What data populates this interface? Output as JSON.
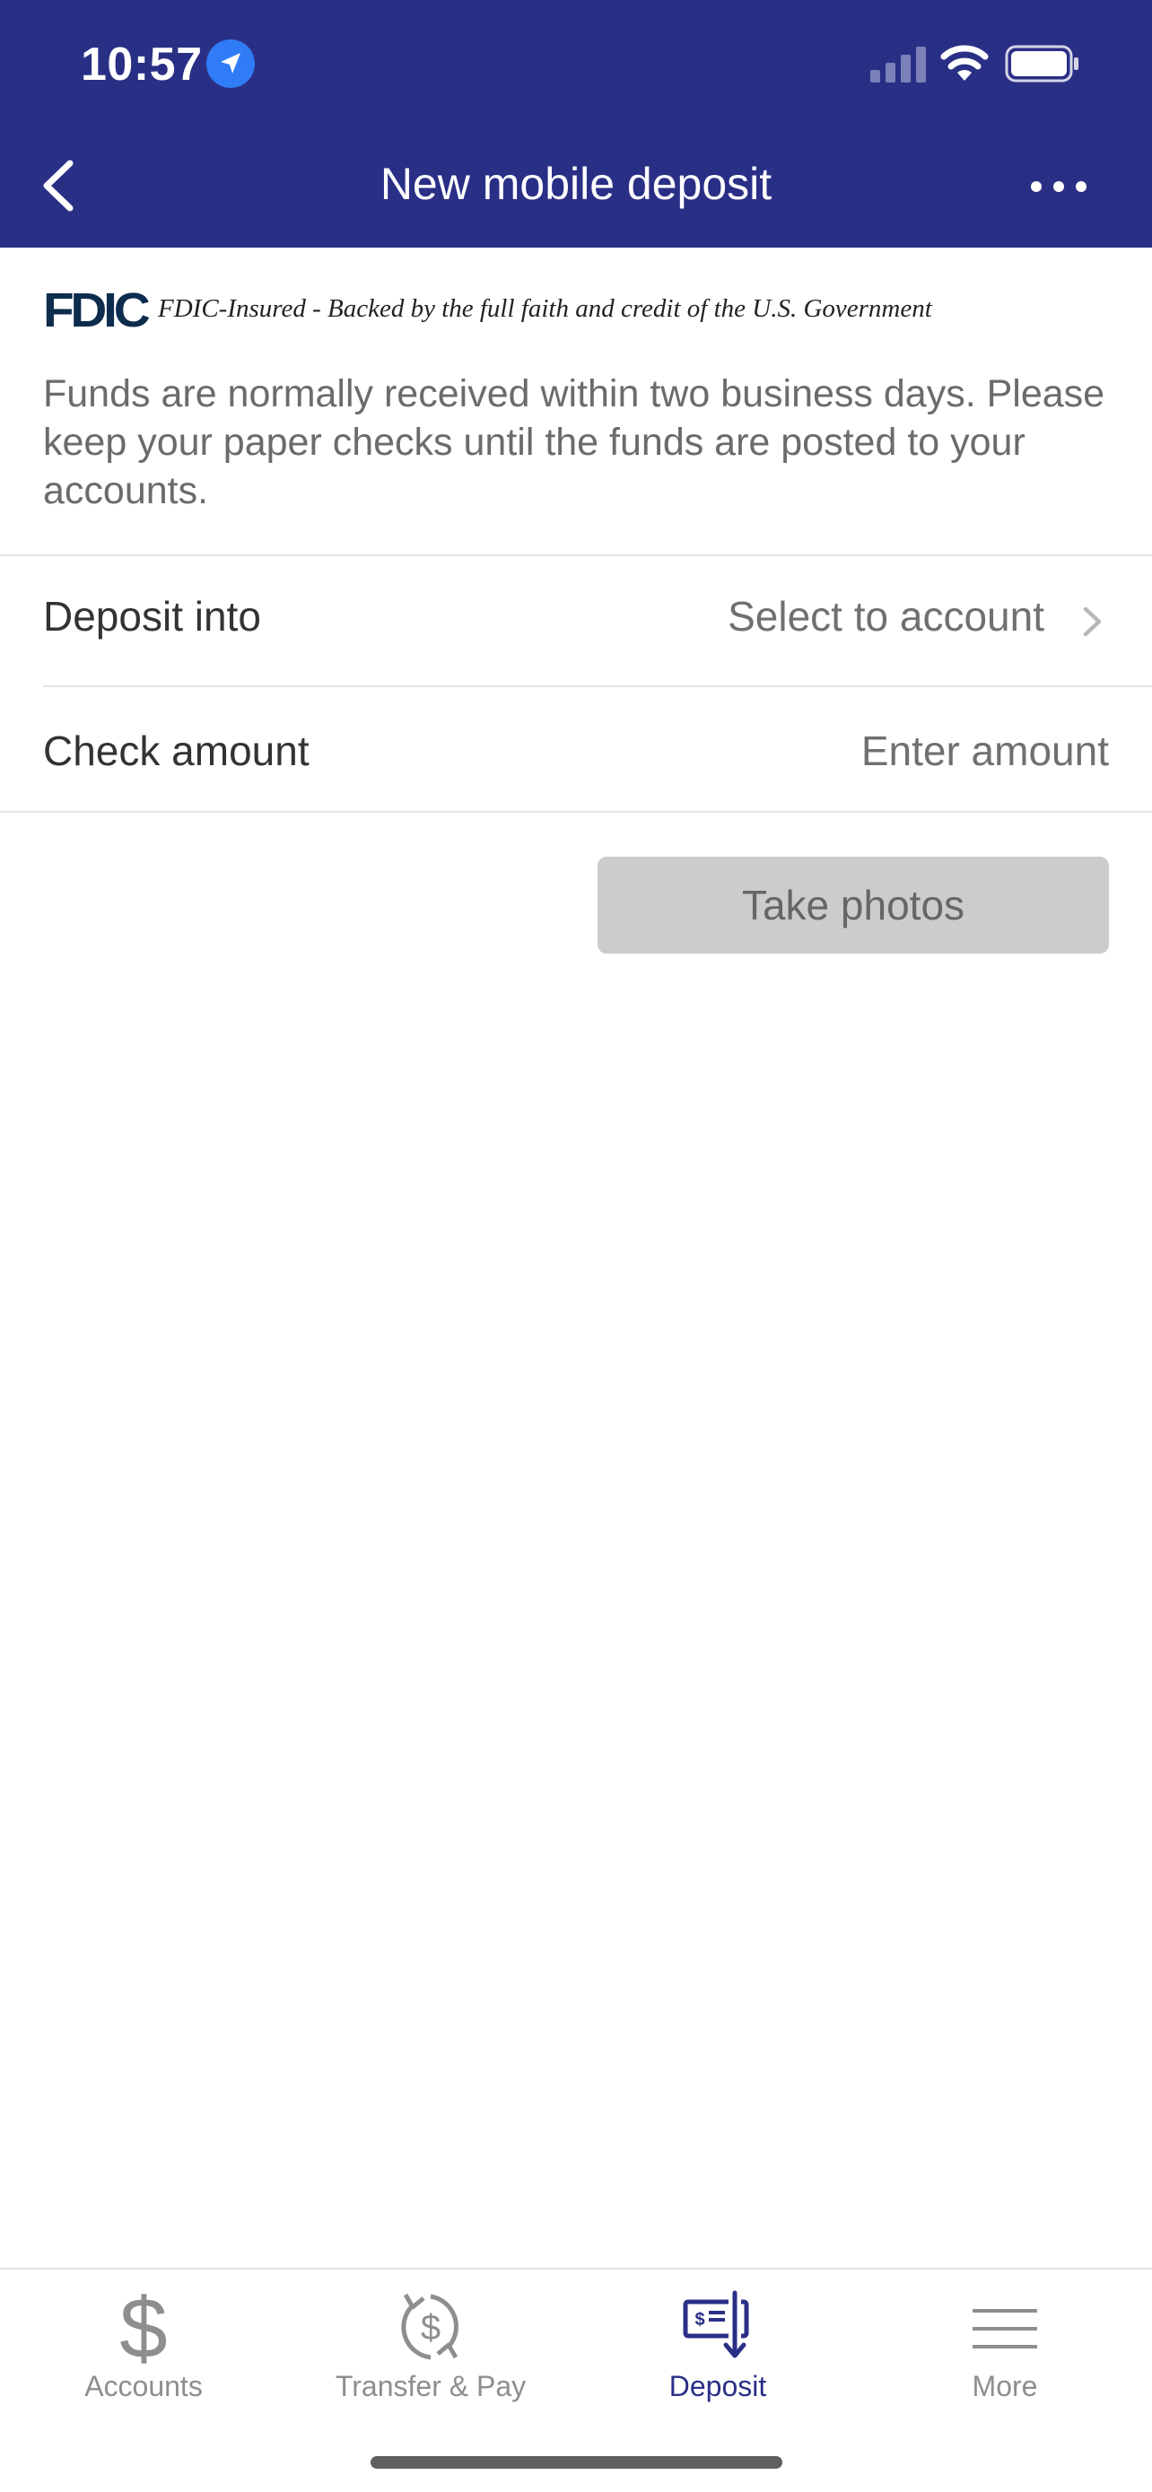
{
  "colors": {
    "brand": "#2a2f86",
    "accent": "#2f7cf6",
    "disabled_button": "#cccccc"
  },
  "status_bar": {
    "time": "10:57",
    "icons": [
      "location-icon",
      "signal-icon",
      "wifi-icon",
      "battery-icon"
    ]
  },
  "header": {
    "title": "New mobile deposit",
    "back_icon": "chevron-left-icon",
    "more_icon": "ellipsis-icon"
  },
  "fdic": {
    "logo": "FDIC",
    "text": "FDIC-Insured - Backed by the full faith and credit of the U.S. Government"
  },
  "info": {
    "text": "Funds are normally received within two business days. Please keep your paper checks until the funds are posted to your accounts."
  },
  "form": {
    "deposit_into": {
      "label": "Deposit into",
      "value": "Select to account"
    },
    "check_amount": {
      "label": "Check amount",
      "placeholder": "Enter amount"
    }
  },
  "take_photos": {
    "label": "Take photos",
    "enabled": false
  },
  "tabs": [
    {
      "label": "Accounts",
      "icon": "dollar-icon",
      "active": false
    },
    {
      "label": "Transfer & Pay",
      "icon": "transfer-pay-icon",
      "active": false
    },
    {
      "label": "Deposit",
      "icon": "deposit-check-icon",
      "active": true
    },
    {
      "label": "More",
      "icon": "menu-icon",
      "active": false
    }
  ]
}
